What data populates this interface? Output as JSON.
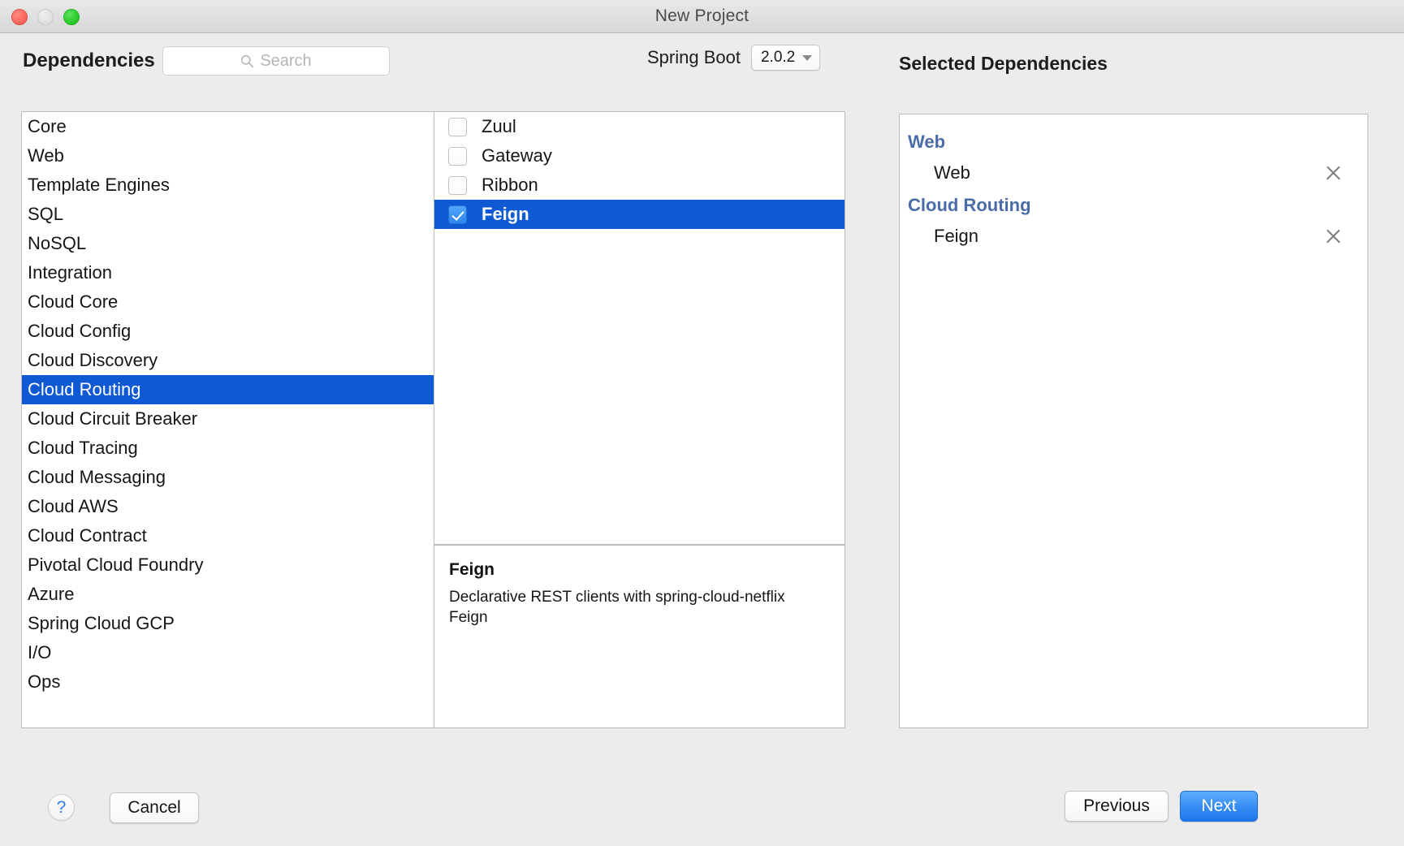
{
  "window": {
    "title": "New Project",
    "traffic_lights": [
      "close",
      "minimize",
      "maximize"
    ]
  },
  "header": {
    "dependencies_label": "Dependencies",
    "search_placeholder": "Search",
    "search_value": "",
    "spring_boot_label": "Spring Boot",
    "spring_boot_version": "2.0.2",
    "selected_dependencies_label": "Selected Dependencies"
  },
  "categories": {
    "selected": "Cloud Routing",
    "items": [
      {
        "label": "Core"
      },
      {
        "label": "Web"
      },
      {
        "label": "Template Engines"
      },
      {
        "label": "SQL"
      },
      {
        "label": "NoSQL"
      },
      {
        "label": "Integration"
      },
      {
        "label": "Cloud Core"
      },
      {
        "label": "Cloud Config"
      },
      {
        "label": "Cloud Discovery"
      },
      {
        "label": "Cloud Routing"
      },
      {
        "label": "Cloud Circuit Breaker"
      },
      {
        "label": "Cloud Tracing"
      },
      {
        "label": "Cloud Messaging"
      },
      {
        "label": "Cloud AWS"
      },
      {
        "label": "Cloud Contract"
      },
      {
        "label": "Pivotal Cloud Foundry"
      },
      {
        "label": "Azure"
      },
      {
        "label": "Spring Cloud GCP"
      },
      {
        "label": "I/O"
      },
      {
        "label": "Ops"
      }
    ]
  },
  "dependencies": {
    "items": [
      {
        "label": "Zuul",
        "checked": false,
        "selected": false
      },
      {
        "label": "Gateway",
        "checked": false,
        "selected": false
      },
      {
        "label": "Ribbon",
        "checked": false,
        "selected": false
      },
      {
        "label": "Feign",
        "checked": true,
        "selected": true
      }
    ]
  },
  "description": {
    "title": "Feign",
    "text": "Declarative REST clients with spring-cloud-netflix Feign"
  },
  "selected_dependencies": {
    "groups": [
      {
        "title": "Web",
        "items": [
          {
            "label": "Web",
            "remove": "×"
          }
        ]
      },
      {
        "title": "Cloud Routing",
        "items": [
          {
            "label": "Feign",
            "remove": "×"
          }
        ]
      }
    ]
  },
  "footer": {
    "help_label": "?",
    "cancel_label": "Cancel",
    "previous_label": "Previous",
    "next_label": "Next"
  },
  "colors": {
    "selection_blue": "#1059d4",
    "group_title_blue": "#4a6ca8",
    "primary_button_blue": "#3b8ff5",
    "checkbox_blue": "#2e87f0",
    "window_background": "#ececec"
  }
}
